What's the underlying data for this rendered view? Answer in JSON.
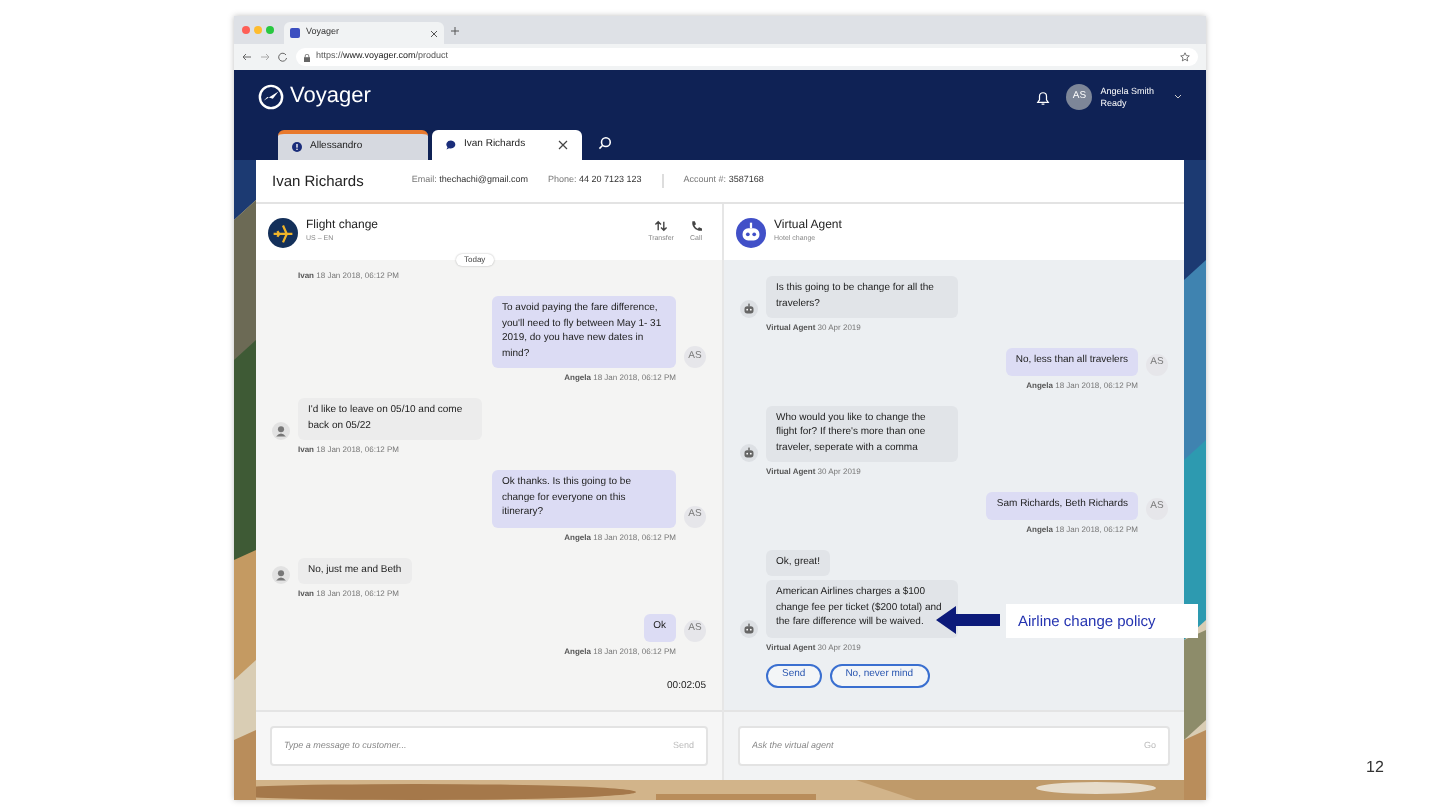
{
  "browser": {
    "tab_title": "Voyager",
    "url_prefix": "https://",
    "url_host": "www.voyager.com",
    "url_path": "/product"
  },
  "app": {
    "logo": "Voyager",
    "user": {
      "initials": "AS",
      "name": "Angela Smith",
      "status": "Ready"
    }
  },
  "tabs": [
    {
      "label": "Allessandro",
      "selected": false,
      "alert": true
    },
    {
      "label": "Ivan Richards",
      "selected": true,
      "alert": false
    }
  ],
  "customer": {
    "name": "Ivan Richards",
    "fields": [
      {
        "label": "Email:",
        "value": "thechachi@gmail.com"
      },
      {
        "label": "Phone:",
        "value": "44 20 7123 123"
      },
      {
        "label": "Account #:",
        "value": "3587168"
      }
    ]
  },
  "left_panel": {
    "title": "Flight change",
    "subtitle": "US – EN",
    "actions": [
      {
        "kind": "transfer",
        "label": "Transfer"
      },
      {
        "kind": "call",
        "label": "Call"
      }
    ],
    "day_label": "Today",
    "messages": [
      {
        "kind": "customer",
        "author": "Ivan",
        "time": "18 Jan 2018, 06:12 PM"
      },
      {
        "kind": "agent",
        "bubbles": [
          "To avoid paying the fare difference, you'll need to fly between May 1- 31 2019, do you have new dates in mind?"
        ],
        "avatar": "AS",
        "author": "Angela",
        "time": "18 Jan 2018, 06:12 PM"
      },
      {
        "kind": "customer",
        "bubbles": [
          "I'd like to leave on 05/10 and come back on 05/22"
        ],
        "author": "Ivan",
        "time": "18 Jan 2018, 06:12 PM"
      },
      {
        "kind": "agent",
        "bubbles": [
          "Ok thanks. Is this going to be change for everyone on this itinerary?"
        ],
        "avatar": "AS",
        "author": "Angela",
        "time": "18 Jan 2018, 06:12 PM"
      },
      {
        "kind": "customer",
        "bubbles": [
          "No, just me and Beth"
        ],
        "author": "Ivan",
        "time": "18 Jan 2018, 06:12 PM"
      },
      {
        "kind": "agent",
        "bubbles": [
          "Ok"
        ],
        "avatar": "AS",
        "author": "Angela",
        "time": "18 Jan 2018, 06:12 PM"
      }
    ],
    "timer": "00:02:05",
    "input": {
      "placeholder": "Type a message to customer...",
      "button": "Send"
    }
  },
  "right_panel": {
    "title": "Virtual Agent",
    "subtitle": "Hotel change",
    "messages": [
      {
        "kind": "bot",
        "bubbles": [
          "Is this going to be change for all the travelers?"
        ],
        "author": "Virtual Agent",
        "time": "30 Apr 2019"
      },
      {
        "kind": "agent",
        "bubbles": [
          "No, less than all travelers"
        ],
        "avatar": "AS",
        "author": "Angela",
        "time": "18 Jan 2018, 06:12 PM"
      },
      {
        "kind": "bot",
        "bubbles": [
          "Who would you like to change the flight for? If there's more than one traveler, seperate with a comma"
        ],
        "author": "Virtual Agent",
        "time": "30 Apr 2019"
      },
      {
        "kind": "agent",
        "bubbles": [
          "Sam Richards, Beth Richards"
        ],
        "avatar": "AS",
        "author": "Angela",
        "time": "18 Jan 2018, 06:12 PM"
      },
      {
        "kind": "bot",
        "bubbles": [
          "Ok, great!",
          "American Airlines charges a $100 change fee per ticket ($200 total) and the fare difference will be waived."
        ],
        "author": "Virtual Agent",
        "time": "30 Apr 2019"
      }
    ],
    "quick_replies": [
      "Send",
      "No, never mind"
    ],
    "input": {
      "placeholder": "Ask the virtual agent",
      "button": "Go"
    }
  },
  "callout": "Airline change policy",
  "slide_number": "12"
}
